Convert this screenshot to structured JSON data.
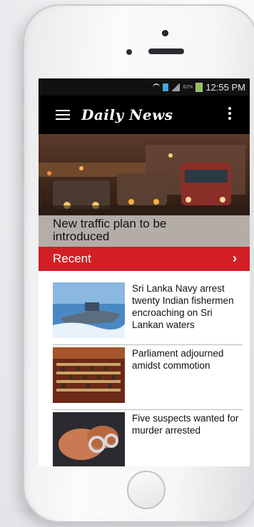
{
  "status_bar": {
    "battery_percent": "62%",
    "time": "12:55 PM"
  },
  "app_bar": {
    "logo_text": "Daily News",
    "menu_icon": "hamburger-menu-icon",
    "overflow_icon": "more-vert-icon"
  },
  "hero": {
    "title": "New traffic plan to be introduced"
  },
  "section": {
    "title": "Recent",
    "chevron": "›"
  },
  "articles": [
    {
      "title": "Sri Lanka Navy arrest twenty Indian fishermen encroaching on Sri Lankan waters"
    },
    {
      "title": "Parliament adjourned amidst commotion"
    },
    {
      "title": "Five suspects wanted for murder arrested"
    }
  ],
  "colors": {
    "accent": "#d21f26",
    "appbar": "#000000",
    "statusbar": "#111111"
  }
}
